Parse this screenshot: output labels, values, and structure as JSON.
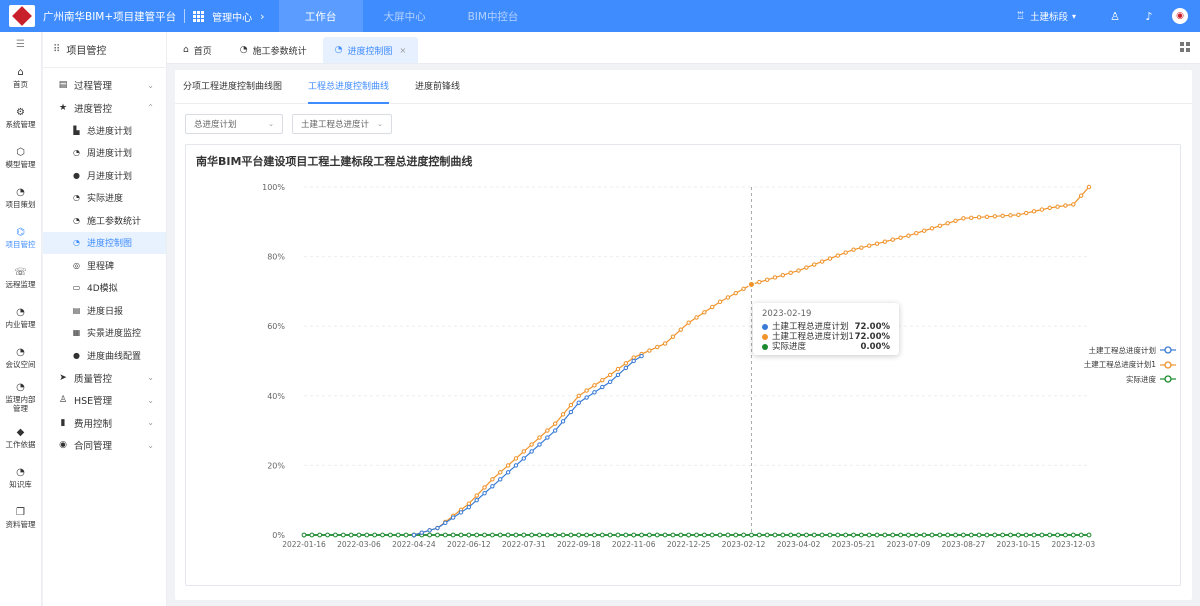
{
  "header": {
    "brand": "广州南华BIM+项目建管平台",
    "module": "管理中心",
    "nav": [
      {
        "label": "工作台",
        "active": true
      },
      {
        "label": "大屏中心",
        "active": false
      },
      {
        "label": "BIM中控台",
        "active": false
      }
    ],
    "section": "土建标段"
  },
  "rail": [
    {
      "label": "首页",
      "icon": "home-icon",
      "glyph": "⌂"
    },
    {
      "label": "系统管理",
      "icon": "gear-icon",
      "glyph": "⚙"
    },
    {
      "label": "模型管理",
      "icon": "cube-icon",
      "glyph": "⬡"
    },
    {
      "label": "项目策划",
      "icon": "plan-icon",
      "glyph": "◔"
    },
    {
      "label": "项目管控",
      "icon": "project-icon",
      "glyph": "⌬",
      "active": true
    },
    {
      "label": "远程监理",
      "icon": "remote-icon",
      "glyph": "☏"
    },
    {
      "label": "内业管理",
      "icon": "office-icon",
      "glyph": "◔"
    },
    {
      "label": "会议空间",
      "icon": "meeting-icon",
      "glyph": "◔"
    },
    {
      "label": "监理内部",
      "label2": "管理",
      "icon": "internal-icon",
      "glyph": "◔"
    },
    {
      "label": "工作依据",
      "icon": "basis-icon",
      "glyph": "◆"
    },
    {
      "label": "知识库",
      "icon": "knowledge-icon",
      "glyph": "◔"
    },
    {
      "label": "资料管理",
      "icon": "docs-icon",
      "glyph": "❐"
    }
  ],
  "menu": {
    "title": "项目管控",
    "groups": [
      {
        "label": "过程管理",
        "glyph": "▤",
        "icon": "process-icon",
        "arrow": "⌄"
      },
      {
        "label": "进度管控",
        "glyph": "★",
        "icon": "star-icon",
        "arrow": "⌃"
      }
    ],
    "sub": [
      {
        "label": "总进度计划",
        "glyph": "▙",
        "icon": "lock-icon"
      },
      {
        "label": "周进度计划",
        "glyph": "◔",
        "icon": "week-icon"
      },
      {
        "label": "月进度计划",
        "glyph": "●",
        "icon": "month-icon"
      },
      {
        "label": "实际进度",
        "glyph": "◔",
        "icon": "actual-icon"
      },
      {
        "label": "施工参数统计",
        "glyph": "◔",
        "icon": "stats-icon"
      },
      {
        "label": "进度控制图",
        "glyph": "◔",
        "icon": "control-chart-icon",
        "active": true
      },
      {
        "label": "里程碑",
        "glyph": "◎",
        "icon": "milestone-icon"
      },
      {
        "label": "4D模拟",
        "glyph": "▭",
        "icon": "video-icon"
      },
      {
        "label": "进度日报",
        "glyph": "▤",
        "icon": "report-icon"
      },
      {
        "label": "实景进度监控",
        "glyph": "▦",
        "icon": "monitor-icon"
      },
      {
        "label": "进度曲线配置",
        "glyph": "●",
        "icon": "config-icon"
      }
    ],
    "groups2": [
      {
        "label": "质量管控",
        "glyph": "➤",
        "icon": "quality-icon",
        "arrow": "⌄"
      },
      {
        "label": "HSE管理",
        "glyph": "♙",
        "icon": "hse-icon",
        "arrow": "⌄"
      },
      {
        "label": "费用控制",
        "glyph": "▮",
        "icon": "cost-icon",
        "arrow": "⌄"
      },
      {
        "label": "合同管理",
        "glyph": "◉",
        "icon": "contract-icon",
        "arrow": "⌄"
      }
    ]
  },
  "tabs": [
    {
      "label": "首页",
      "glyph": "⌂",
      "icon": "home-icon"
    },
    {
      "label": "施工参数统计",
      "glyph": "◔",
      "icon": "stats-icon"
    },
    {
      "label": "进度控制图",
      "glyph": "◔",
      "icon": "control-chart-icon",
      "active": true
    }
  ],
  "subtabs": [
    {
      "label": "分项工程进度控制曲线图"
    },
    {
      "label": "工程总进度控制曲线",
      "active": true
    },
    {
      "label": "进度前锋线"
    }
  ],
  "filters": {
    "plan_select": "总进度计划",
    "series_select": "土建工程总进度计"
  },
  "tooltip": {
    "date": "2023-02-19",
    "rows": [
      {
        "name": "土建工程总进度计划",
        "value": "72.00%",
        "color": "#3a7bd5"
      },
      {
        "name": "土建工程总进度计划1",
        "value": "72.00%",
        "color": "#f0932b"
      },
      {
        "name": "实际进度",
        "value": "0.00%",
        "color": "#1a8a2e"
      }
    ]
  },
  "chart_data": {
    "type": "line",
    "title": "南华BIM平台建设项目工程土建标段工程总进度控制曲线",
    "xlabel": "",
    "ylabel": "",
    "x_ticks": [
      "2022-01-16",
      "2022-03-06",
      "2022-04-24",
      "2022-06-12",
      "2022-07-31",
      "2022-09-18",
      "2022-11-06",
      "2022-12-25",
      "2023-02-12",
      "2023-04-02",
      "2023-05-21",
      "2023-07-09",
      "2023-08-27",
      "2023-10-15",
      "2023-12-03"
    ],
    "y_ticks": [
      "0%",
      "20%",
      "40%",
      "60%",
      "80%",
      "100%"
    ],
    "ylim": [
      0,
      100
    ],
    "x_range": [
      "2022-01-16",
      "2023-12-17"
    ],
    "crosshair_date": "2023-02-19",
    "legend_position": "right",
    "series": [
      {
        "name": "土建工程总进度计划",
        "color": "#3a7bd5",
        "points": [
          [
            "2022-04-24",
            0
          ],
          [
            "2022-05-15",
            2
          ],
          [
            "2022-06-12",
            8
          ],
          [
            "2022-07-03",
            14
          ],
          [
            "2022-07-31",
            22
          ],
          [
            "2022-08-28",
            30
          ],
          [
            "2022-09-18",
            38
          ],
          [
            "2022-10-16",
            44
          ],
          [
            "2022-11-06",
            50
          ],
          [
            "2022-11-16",
            52
          ]
        ]
      },
      {
        "name": "土建工程总进度计划1",
        "color": "#f0932b",
        "points": [
          [
            "2022-04-24",
            0
          ],
          [
            "2022-05-15",
            2
          ],
          [
            "2022-06-12",
            9
          ],
          [
            "2022-07-03",
            16
          ],
          [
            "2022-07-31",
            24
          ],
          [
            "2022-08-28",
            32
          ],
          [
            "2022-09-18",
            40
          ],
          [
            "2022-10-16",
            46
          ],
          [
            "2022-11-06",
            51
          ],
          [
            "2022-12-04",
            55
          ],
          [
            "2022-12-25",
            61
          ],
          [
            "2023-01-22",
            67
          ],
          [
            "2023-02-19",
            72
          ],
          [
            "2023-04-02",
            76
          ],
          [
            "2023-05-21",
            82
          ],
          [
            "2023-07-09",
            86
          ],
          [
            "2023-08-27",
            91
          ],
          [
            "2023-10-15",
            92
          ],
          [
            "2023-11-12",
            94
          ],
          [
            "2023-12-03",
            95
          ],
          [
            "2023-12-17",
            100
          ]
        ]
      },
      {
        "name": "实际进度",
        "color": "#1a8a2e",
        "points": [
          [
            "2022-01-16",
            0
          ],
          [
            "2023-12-17",
            0
          ]
        ]
      }
    ]
  }
}
